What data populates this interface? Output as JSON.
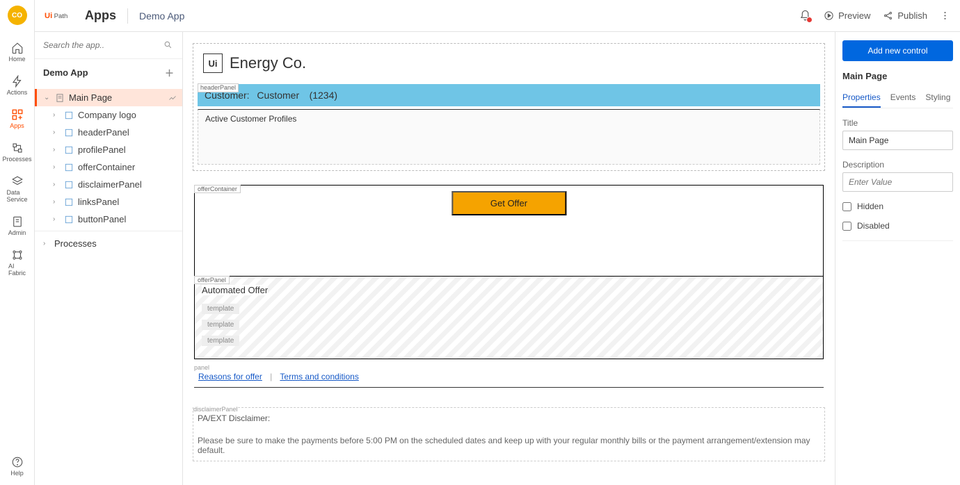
{
  "avatar_initials": "CO",
  "rail": {
    "home": "Home",
    "actions": "Actions",
    "apps": "Apps",
    "processes": "Processes",
    "dataservice": "Data\nService",
    "admin": "Admin",
    "aifabric": "AI\nFabric",
    "help": "Help"
  },
  "brand": {
    "apps_label": "Apps",
    "app_name": "Demo App"
  },
  "topbar": {
    "preview": "Preview",
    "publish": "Publish"
  },
  "search": {
    "placeholder": "Search the app.."
  },
  "tree": {
    "header": "Demo App",
    "main_page": "Main Page",
    "items": [
      "Company logo",
      "headerPanel",
      "profilePanel",
      "offerContainer",
      "disclaimerPanel",
      "linksPanel",
      "buttonPanel"
    ],
    "processes": "Processes"
  },
  "canvas": {
    "company": "Energy Co.",
    "ui_box": "Ui",
    "header_tag": "headerPanel",
    "header_label": "Customer:",
    "header_name": "Customer",
    "header_id": "(1234)",
    "profiles_title": "Active Customer Profiles",
    "oc_tag": "offerContainer",
    "get_offer": "Get Offer",
    "op_tag": "offerPanel",
    "op_title": "Automated Offer",
    "template": "template",
    "links_tag": "panel",
    "link1": "Reasons for offer",
    "link2": "Terms and conditions",
    "d_tag": "disclaimerPanel",
    "d_title": "PA/EXT Disclaimer:",
    "d_body": "Please be sure to make the payments before 5:00 PM on the scheduled dates and keep up with your regular monthly bills or the payment arrangement/extension may default."
  },
  "props": {
    "add": "Add new control",
    "page_label": "Main Page",
    "tab_props": "Properties",
    "tab_events": "Events",
    "tab_styling": "Styling",
    "title_label": "Title",
    "title_value": "Main Page",
    "desc_label": "Description",
    "desc_placeholder": "Enter Value",
    "hidden": "Hidden",
    "disabled": "Disabled"
  }
}
